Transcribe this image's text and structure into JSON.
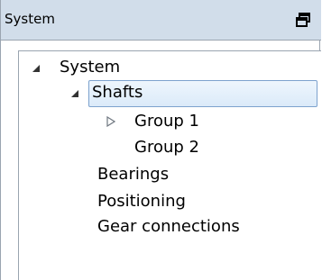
{
  "panel": {
    "title": "System",
    "float_icon": "float-window-icon"
  },
  "tree": {
    "root": {
      "label": "System",
      "expanded": true,
      "icon": "expanded-triangle-icon"
    },
    "shafts": {
      "label": "Shafts",
      "expanded": true,
      "selected": true,
      "icon": "expanded-triangle-icon"
    },
    "group1": {
      "label": "Group 1",
      "expanded": false,
      "icon": "collapsed-triangle-icon"
    },
    "group2": {
      "label": "Group 2"
    },
    "bearings": {
      "label": "Bearings"
    },
    "positioning": {
      "label": "Positioning"
    },
    "gear_connections": {
      "label": "Gear connections"
    }
  },
  "colors": {
    "titlebar_bg": "#d1ddea",
    "border": "#9aa4b0",
    "selection_border": "#7da2ce",
    "selection_bg": "#dbeaf9"
  }
}
